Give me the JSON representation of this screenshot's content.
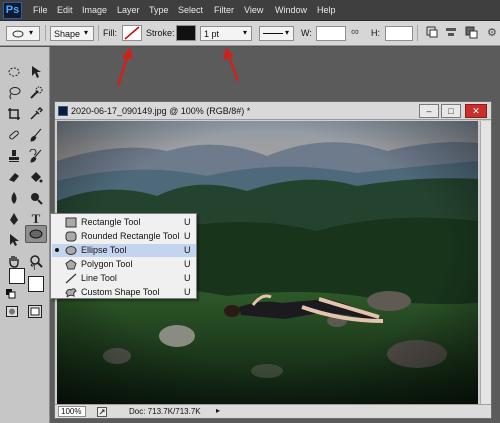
{
  "app": {
    "logo_text": "Ps"
  },
  "menu": [
    "File",
    "Edit",
    "Image",
    "Layer",
    "Type",
    "Select",
    "Filter",
    "View",
    "Window",
    "Help"
  ],
  "options_bar": {
    "mode_value": "Shape",
    "fill_label": "Fill:",
    "stroke_label": "Stroke:",
    "stroke_width_value": "1 pt",
    "w_label": "W:",
    "h_label": "H:",
    "link_icon": "link-icon",
    "colors": {
      "stroke_swatch": "#111111",
      "fill_none_line": "#d40000",
      "arrow": "#d0201c"
    }
  },
  "document": {
    "title": "2020-06-17_090149.jpg @ 100% (RGB/8#) *",
    "minimize_label": "–",
    "restore_label": "□",
    "close_label": "✕",
    "zoom_value": "100%",
    "doc_info": "Doc: 713.7K/713.7K"
  },
  "flyout": {
    "items": [
      {
        "label": "Rectangle Tool",
        "shortcut": "U",
        "icon": "rectangle-icon",
        "selected": false
      },
      {
        "label": "Rounded Rectangle Tool",
        "shortcut": "U",
        "icon": "rounded-rectangle-icon",
        "selected": false
      },
      {
        "label": "Ellipse Tool",
        "shortcut": "U",
        "icon": "ellipse-icon",
        "selected": true
      },
      {
        "label": "Polygon Tool",
        "shortcut": "U",
        "icon": "polygon-icon",
        "selected": false
      },
      {
        "label": "Line Tool",
        "shortcut": "U",
        "icon": "line-icon",
        "selected": false
      },
      {
        "label": "Custom Shape Tool",
        "shortcut": "U",
        "icon": "custom-shape-icon",
        "selected": false
      }
    ]
  },
  "toolbar": {
    "type_tool_glyph": "T"
  }
}
